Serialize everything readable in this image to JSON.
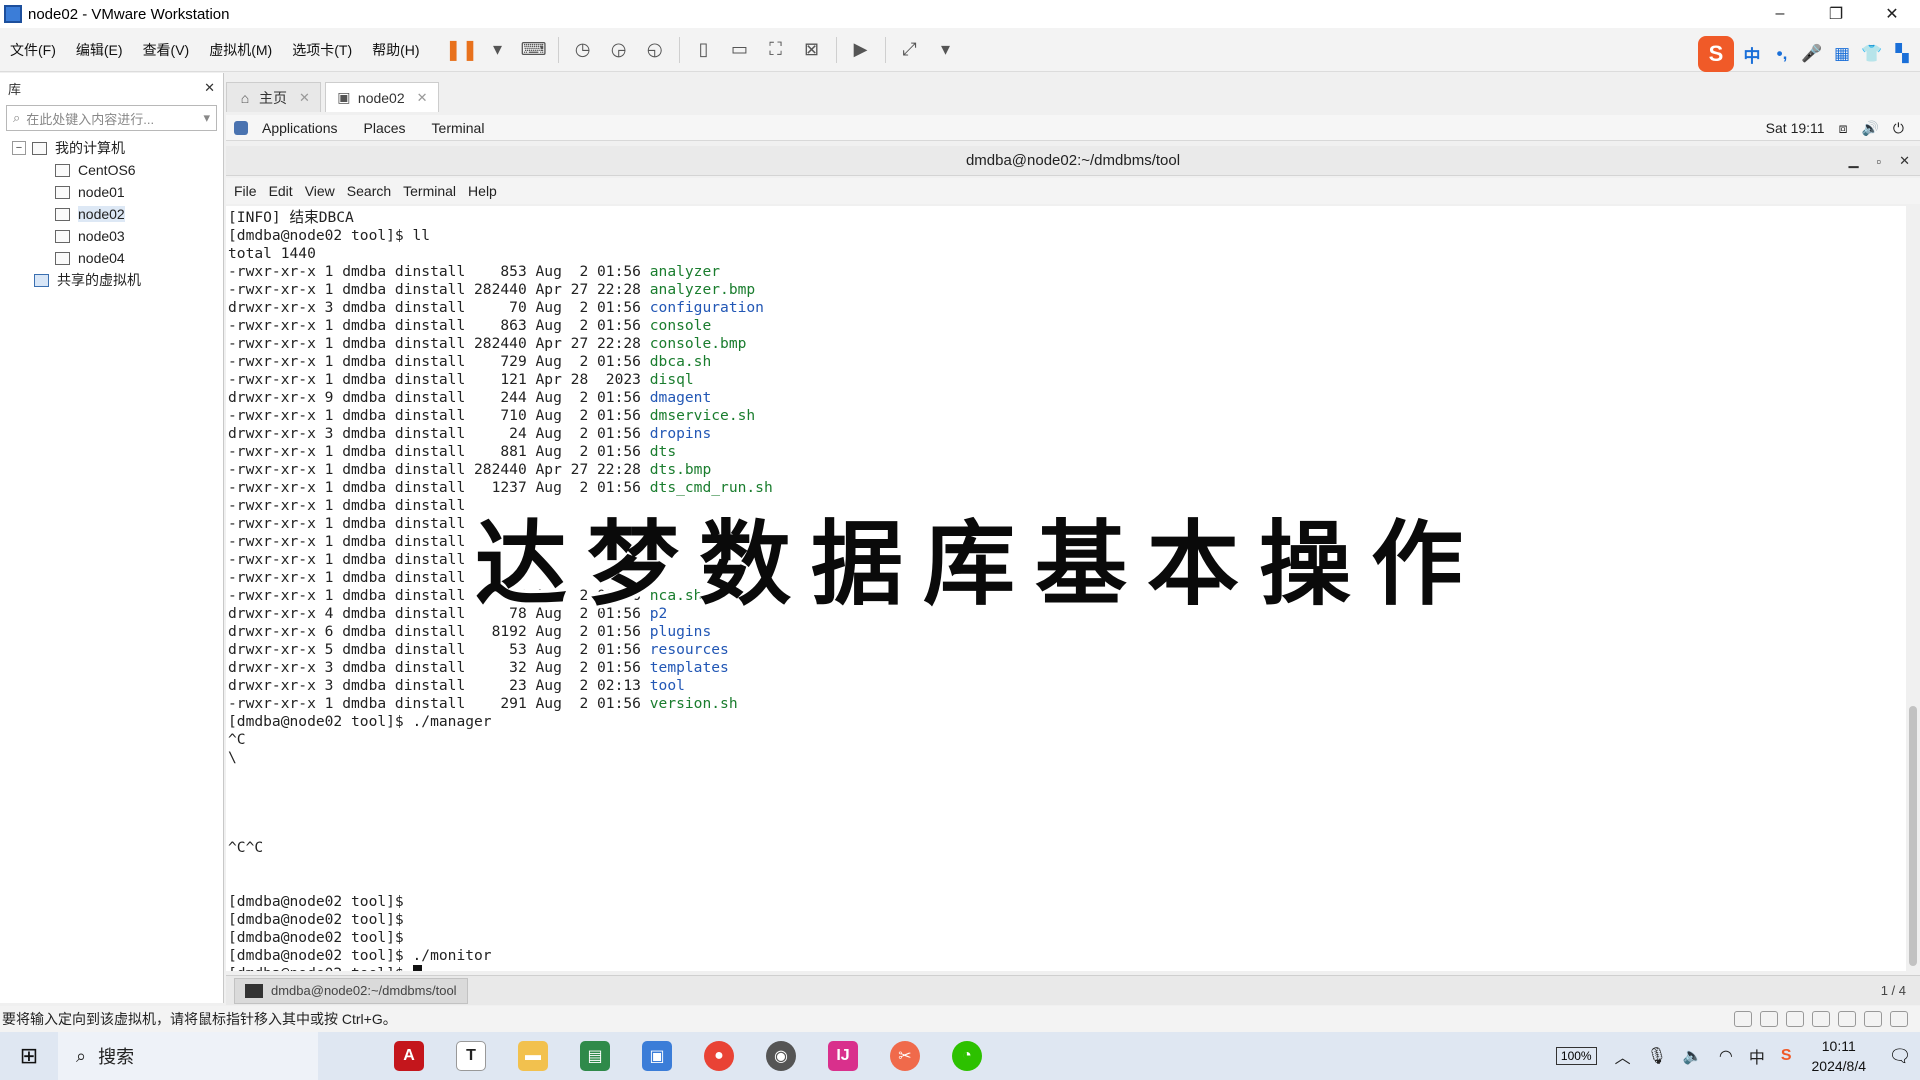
{
  "window": {
    "title": "node02 - VMware Workstation",
    "controls": {
      "minimize": "–",
      "restore": "❐",
      "close": "✕"
    }
  },
  "menubar": {
    "items": [
      "文件(F)",
      "编辑(E)",
      "查看(V)",
      "虚拟机(M)",
      "选项卡(T)",
      "帮助(H)"
    ]
  },
  "library": {
    "title": "库",
    "close": "✕",
    "search_placeholder": "在此处键入内容进行...",
    "root": "我的计算机",
    "vms": [
      "CentOS6",
      "node01",
      "node02",
      "node03",
      "node04"
    ],
    "selected": "node02",
    "shared": "共享的虚拟机"
  },
  "tabs": [
    {
      "label": "主页",
      "active": false
    },
    {
      "label": "node02",
      "active": true
    }
  ],
  "guest_topbar": {
    "applications": "Applications",
    "places": "Places",
    "terminal": "Terminal",
    "clock": "Sat 19:11"
  },
  "terminal": {
    "title": "dmdba@node02:~/dmdbms/tool",
    "menu": [
      "File",
      "Edit",
      "View",
      "Search",
      "Terminal",
      "Help"
    ],
    "lines": [
      {
        "t": "[INFO] 结束DBCA"
      },
      {
        "t": "[dmdba@node02 tool]$ ll"
      },
      {
        "t": "total 1440"
      },
      {
        "p": "-rwxr-xr-x 1 dmdba dinstall    853 Aug  2 01:56 ",
        "n": "analyzer",
        "c": "fn"
      },
      {
        "p": "-rwxr-xr-x 1 dmdba dinstall 282440 Apr 27 22:28 ",
        "n": "analyzer.bmp",
        "c": "fn"
      },
      {
        "p": "drwxr-xr-x 3 dmdba dinstall     70 Aug  2 01:56 ",
        "n": "configuration",
        "c": "dn"
      },
      {
        "p": "-rwxr-xr-x 1 dmdba dinstall    863 Aug  2 01:56 ",
        "n": "console",
        "c": "fn"
      },
      {
        "p": "-rwxr-xr-x 1 dmdba dinstall 282440 Apr 27 22:28 ",
        "n": "console.bmp",
        "c": "fn"
      },
      {
        "p": "-rwxr-xr-x 1 dmdba dinstall    729 Aug  2 01:56 ",
        "n": "dbca.sh",
        "c": "fn"
      },
      {
        "p": "-rwxr-xr-x 1 dmdba dinstall    121 Apr 28  2023 ",
        "n": "disql",
        "c": "fn"
      },
      {
        "p": "drwxr-xr-x 9 dmdba dinstall    244 Aug  2 01:56 ",
        "n": "dmagent",
        "c": "dn"
      },
      {
        "p": "-rwxr-xr-x 1 dmdba dinstall    710 Aug  2 01:56 ",
        "n": "dmservice.sh",
        "c": "fn"
      },
      {
        "p": "drwxr-xr-x 3 dmdba dinstall     24 Aug  2 01:56 ",
        "n": "dropins",
        "c": "dn"
      },
      {
        "p": "-rwxr-xr-x 1 dmdba dinstall    881 Aug  2 01:56 ",
        "n": "dts",
        "c": "fn"
      },
      {
        "p": "-rwxr-xr-x 1 dmdba dinstall 282440 Apr 27 22:28 ",
        "n": "dts.bmp",
        "c": "fn"
      },
      {
        "p": "-rwxr-xr-x 1 dmdba dinstall   1237 Aug  2 01:56 ",
        "n": "dts_cmd_run.sh",
        "c": "fn"
      },
      {
        "p": "-rwxr-xr-x 1 dmdba dinstall    ",
        "n": "",
        "c": "fn"
      },
      {
        "p": "-rwxr-xr-x 1 dmdba dinstall    ",
        "n": "",
        "c": "fn"
      },
      {
        "p": "-rwxr-xr-x 1 dmdba dinstall    ",
        "n": "",
        "c": "fn"
      },
      {
        "p": "-rwxr-xr-x 1 dmdba dinstall    ",
        "n": "",
        "c": "fn"
      },
      {
        "p": "-rwxr-xr-x 1 dmdba dinstall    ",
        "n": "",
        "c": "fn"
      },
      {
        "p": "-rwxr-xr-x 1 dmdba dinstall    694 Aug  2 01:56 ",
        "n": "nca.sh",
        "c": "fn"
      },
      {
        "p": "drwxr-xr-x 4 dmdba dinstall     78 Aug  2 01:56 ",
        "n": "p2",
        "c": "dn"
      },
      {
        "p": "drwxr-xr-x 6 dmdba dinstall   8192 Aug  2 01:56 ",
        "n": "plugins",
        "c": "dn"
      },
      {
        "p": "drwxr-xr-x 5 dmdba dinstall     53 Aug  2 01:56 ",
        "n": "resources",
        "c": "dn"
      },
      {
        "p": "drwxr-xr-x 3 dmdba dinstall     32 Aug  2 01:56 ",
        "n": "templates",
        "c": "dn"
      },
      {
        "p": "drwxr-xr-x 3 dmdba dinstall     23 Aug  2 02:13 ",
        "n": "tool",
        "c": "dn"
      },
      {
        "p": "-rwxr-xr-x 1 dmdba dinstall    291 Aug  2 01:56 ",
        "n": "version.sh",
        "c": "fn"
      },
      {
        "t": "[dmdba@node02 tool]$ ./manager"
      },
      {
        "t": "^C"
      },
      {
        "t": "\\"
      },
      {
        "t": ""
      },
      {
        "t": ""
      },
      {
        "t": ""
      },
      {
        "t": ""
      },
      {
        "t": "^C^C"
      },
      {
        "t": ""
      },
      {
        "t": ""
      },
      {
        "t": "[dmdba@node02 tool]$"
      },
      {
        "t": "[dmdba@node02 tool]$"
      },
      {
        "t": "[dmdba@node02 tool]$"
      },
      {
        "t": "[dmdba@node02 tool]$ ./monitor"
      },
      {
        "t": "[dmdba@node02 tool]$ ",
        "cursor": true
      }
    ]
  },
  "overlay_title": "达梦数据库基本操作",
  "guest_taskbar": {
    "window_button": "dmdba@node02:~/dmdbms/tool",
    "pager": "1 / 4"
  },
  "statusbar": {
    "hint": "要将输入定向到该虚拟机，请将鼠标指针移入其中或按 Ctrl+G。"
  },
  "taskbar": {
    "search_label": "搜索",
    "battery": "100%",
    "ime": "中",
    "time": "10:11",
    "date": "2024/8/4"
  },
  "colors": {
    "terminal_file": "#1a7d2e",
    "terminal_dir": "#2257b5",
    "pause_accent": "#e8711c",
    "ime_brand": "#f05a28"
  }
}
